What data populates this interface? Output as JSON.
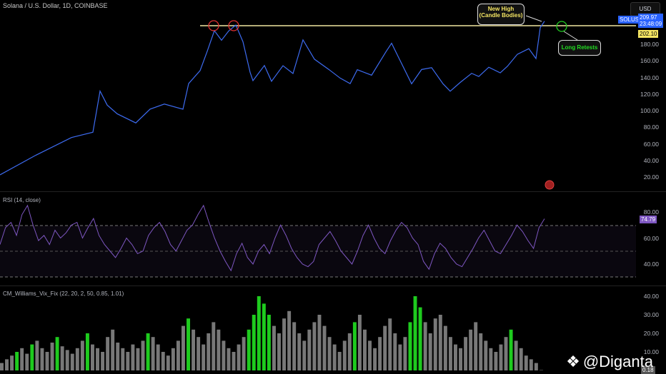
{
  "header": {
    "title": "Solana / U.S. Dollar, 1D, COINBASE",
    "currency": "USD"
  },
  "price_axis": {
    "ticks": [
      "180.00",
      "160.00",
      "140.00",
      "120.00",
      "100.00",
      "80.00",
      "60.00",
      "40.00",
      "20.00"
    ],
    "symbol": "SOLUSD",
    "last_price": "209.97",
    "countdown": "23:48:09",
    "line_level": "202.10"
  },
  "annotations": {
    "new_high": "New High",
    "new_high_sub": "(Candle Bodies)",
    "retest": "Long Retests"
  },
  "rsi": {
    "label": "RSI (14, close)",
    "ticks": [
      "80.00",
      "60.00",
      "40.00"
    ],
    "value": "74.79"
  },
  "vix": {
    "label": "CM_Williams_Vix_Fix (22, 20, 2, 50, 0.85, 1.01)",
    "ticks": [
      "40.00",
      "30.00",
      "20.00",
      "10.00"
    ],
    "value": "0.18"
  },
  "watermark": "@Diganta",
  "colors": {
    "price": "#3d6bf0",
    "level": "#f0e6a0",
    "rsi": "#7e57c2",
    "green": "#1ecb1e",
    "grey": "#787878"
  },
  "chart_data": [
    {
      "type": "line",
      "name": "SOLUSD",
      "x": [
        0,
        25,
        50,
        65,
        70,
        75,
        82,
        95,
        105,
        115,
        128,
        132,
        140,
        145,
        150,
        155,
        160,
        165,
        170,
        175,
        177,
        185,
        190,
        198,
        205,
        212,
        220,
        230,
        238,
        245,
        250,
        260,
        270,
        274,
        280,
        288,
        295,
        302,
        310,
        315,
        322,
        330,
        335,
        342,
        350,
        355,
        362,
        370,
        375,
        378,
        381
      ],
      "y": [
        22.6,
        48.4,
        69.9,
        74.2,
        121.5,
        104.3,
        95.7,
        87.1,
        104.3,
        108.6,
        100,
        130.1,
        147.3,
        173.1,
        198.9,
        186,
        194.6,
        200.6,
        181.7,
        147.3,
        138.7,
        155.9,
        134.4,
        151.6,
        143,
        186,
        164.5,
        151.6,
        138.7,
        130.1,
        147.3,
        143,
        173.1,
        183.4,
        160.2,
        130.1,
        147.3,
        151.6,
        134.4,
        125.8,
        134.4,
        143,
        138.7,
        151.6,
        147.3,
        155.9,
        168.8,
        173.1,
        160.2,
        198.9,
        209.2
      ],
      "level": 202.1
    },
    {
      "type": "line",
      "name": "RSI",
      "y": [
        55,
        68,
        72,
        62,
        78,
        85,
        70,
        58,
        62,
        55,
        66,
        60,
        64,
        70,
        72,
        60,
        68,
        75,
        62,
        55,
        50,
        45,
        52,
        60,
        55,
        48,
        50,
        62,
        68,
        72,
        65,
        55,
        50,
        58,
        66,
        70,
        78,
        85,
        72,
        60,
        50,
        42,
        35,
        48,
        56,
        45,
        40,
        50,
        55,
        48,
        60,
        70,
        62,
        52,
        45,
        40,
        38,
        42,
        55,
        60,
        65,
        58,
        50,
        45,
        40,
        50,
        62,
        70,
        60,
        52,
        48,
        58,
        66,
        72,
        68,
        60,
        55,
        42,
        36,
        48,
        56,
        52,
        45,
        40,
        38,
        45,
        52,
        60,
        66,
        58,
        50,
        48,
        55,
        62,
        70,
        65,
        58,
        52,
        68,
        74.79
      ]
    },
    {
      "type": "bar",
      "name": "Vix Fix",
      "values": [
        4,
        6,
        8,
        10,
        12,
        9,
        14,
        16,
        12,
        10,
        15,
        18,
        13,
        11,
        9,
        12,
        16,
        20,
        14,
        12,
        10,
        18,
        22,
        15,
        12,
        10,
        14,
        12,
        16,
        20,
        18,
        14,
        10,
        8,
        12,
        16,
        24,
        28,
        22,
        18,
        14,
        20,
        26,
        22,
        16,
        12,
        10,
        14,
        18,
        22,
        30,
        40,
        36,
        30,
        24,
        20,
        28,
        32,
        26,
        20,
        16,
        22,
        26,
        30,
        24,
        18,
        14,
        10,
        16,
        20,
        26,
        30,
        22,
        16,
        12,
        18,
        24,
        28,
        20,
        14,
        18,
        26,
        40,
        34,
        26,
        20,
        28,
        30,
        24,
        18,
        14,
        12,
        18,
        22,
        26,
        20,
        16,
        12,
        10,
        14,
        18,
        22,
        16,
        12,
        8,
        6,
        4,
        0.18
      ],
      "highlight": [
        0,
        0,
        0,
        1,
        0,
        0,
        1,
        0,
        0,
        0,
        0,
        1,
        0,
        0,
        0,
        0,
        0,
        1,
        0,
        0,
        0,
        0,
        0,
        0,
        0,
        0,
        0,
        0,
        0,
        1,
        0,
        0,
        0,
        0,
        0,
        0,
        0,
        1,
        0,
        0,
        0,
        0,
        0,
        0,
        0,
        0,
        0,
        0,
        0,
        1,
        1,
        1,
        1,
        1,
        0,
        0,
        0,
        0,
        0,
        0,
        0,
        0,
        0,
        0,
        0,
        0,
        0,
        0,
        0,
        0,
        1,
        0,
        0,
        0,
        0,
        0,
        0,
        0,
        0,
        0,
        0,
        1,
        1,
        1,
        0,
        0,
        0,
        0,
        0,
        0,
        0,
        0,
        0,
        0,
        0,
        0,
        0,
        0,
        0,
        0,
        0,
        1,
        0,
        0,
        0,
        0,
        0,
        0
      ]
    }
  ]
}
